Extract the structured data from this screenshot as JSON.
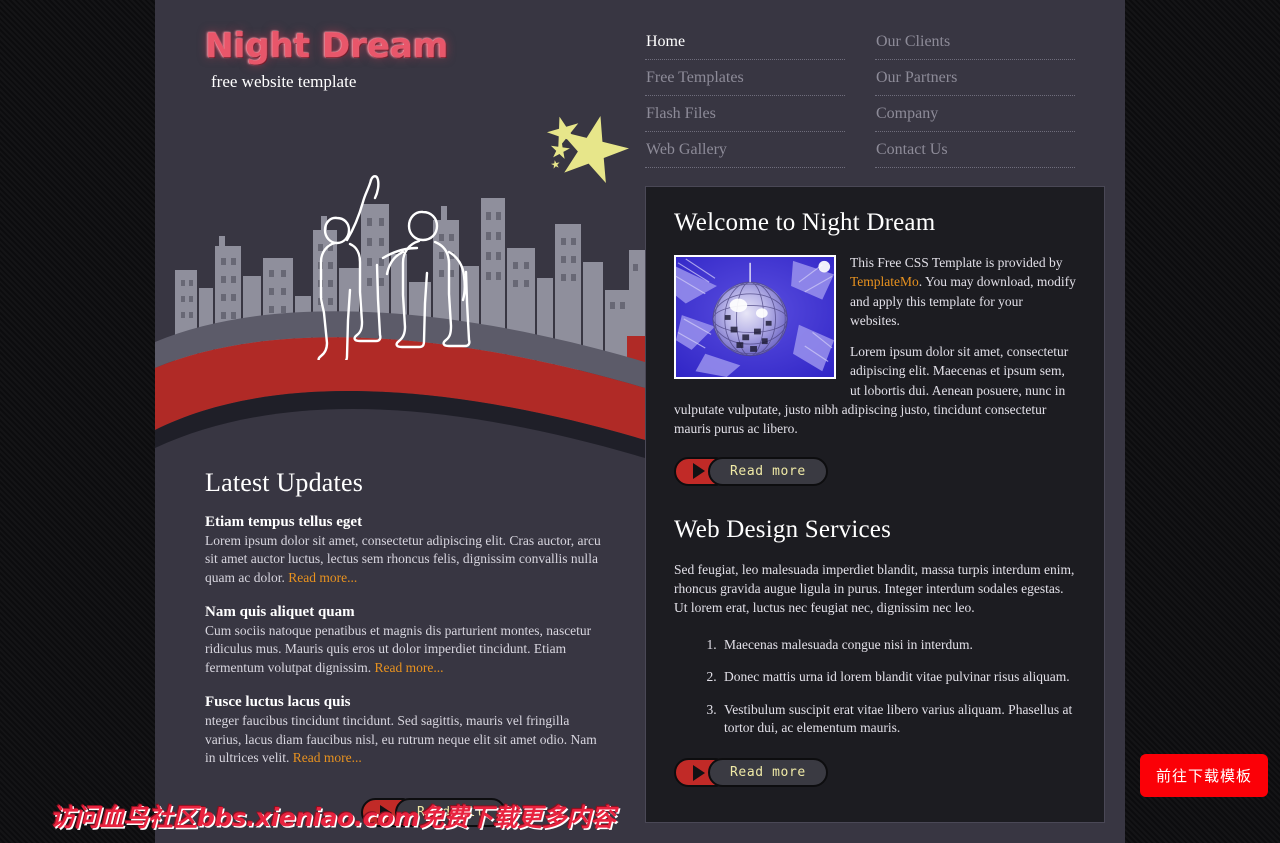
{
  "site": {
    "title": "Night Dream",
    "tagline": "free website template"
  },
  "nav": {
    "columns": [
      [
        {
          "label": "Home",
          "active": true
        },
        {
          "label": "Free Templates",
          "active": false
        },
        {
          "label": "Flash Files",
          "active": false
        },
        {
          "label": "Web Gallery",
          "active": false
        }
      ],
      [
        {
          "label": "Our Clients",
          "active": false
        },
        {
          "label": "Our Partners",
          "active": false
        },
        {
          "label": "Company",
          "active": false
        },
        {
          "label": "Contact Us",
          "active": false
        }
      ]
    ]
  },
  "latest_updates": {
    "title": "Latest Updates",
    "items": [
      {
        "title": "Etiam tempus tellus eget",
        "text": "Lorem ipsum dolor sit amet, consectetur adipiscing elit. Cras auctor, arcu sit amet auctor luctus, lectus sem rhoncus felis, dignissim convallis nulla quam ac dolor. ",
        "link": "Read more..."
      },
      {
        "title": "Nam quis aliquet quam",
        "text": "Cum sociis natoque penatibus et magnis dis parturient montes, nascetur ridiculus mus. Mauris quis eros ut dolor imperdiet tincidunt. Etiam fermentum volutpat dignissim. ",
        "link": "Read more..."
      },
      {
        "title": "Fusce luctus lacus quis",
        "text": "nteger faucibus tincidunt tincidunt. Sed sagittis, mauris vel fringilla varius, lacus diam faucibus nisl, eu rutrum neque elit sit amet odio. Nam in ultrices velit. ",
        "link": "Read more..."
      }
    ],
    "read_all_label": "Read All"
  },
  "welcome": {
    "heading": "Welcome to Night Dream",
    "para1_before": "This Free CSS Template is provided by ",
    "para1_link": "TemplateMo",
    "para1_after": ". You may download, modify and apply this template for your websites.",
    "para2": "Lorem ipsum dolor sit amet, consectetur adipiscing elit. Maecenas et ipsum sem, ut lobortis dui. Aenean posuere, nunc in vulputate vulputate, justo nibh adipiscing justo, tincidunt consectetur mauris purus ac libero.",
    "read_more_label": "Read more",
    "image_alt": "disco-ball-photo"
  },
  "services": {
    "heading": "Web Design Services",
    "intro": "Sed feugiat, leo malesuada imperdiet blandit, massa turpis interdum enim, rhoncus gravida augue ligula in purus. Integer interdum sodales egestas. Ut lorem erat, luctus nec feugiat nec, dignissim nec leo.",
    "list": [
      "Maecenas malesuada congue nisi in interdum.",
      "Donec mattis urna id lorem blandit vitae pulvinar risus aliquam.",
      "Vestibulum suscipit erat vitae libero varius aliquam. Phasellus at tortor dui, ac elementum mauris."
    ],
    "read_more_label": "Read more"
  },
  "overlay": {
    "watermark": "访问血鸟社区bbs.xieniao.com免费下载更多内容",
    "download_button": "前往下载模板"
  },
  "colors": {
    "page_bg": "#141416",
    "container_bg": "#383642",
    "panel_bg": "#1c1c21",
    "panel_border": "#4a4856",
    "accent_red": "#b02a26",
    "button_red": "#c12a27",
    "link_orange": "#e8921f",
    "logo_pink": "#e8566a",
    "star_yellow": "#e7e68a",
    "btn_text_yellow": "#efe9a6",
    "nav_inactive": "#8d8b98",
    "watermark_red": "#e8233f",
    "float_button_red": "#fb0007"
  }
}
